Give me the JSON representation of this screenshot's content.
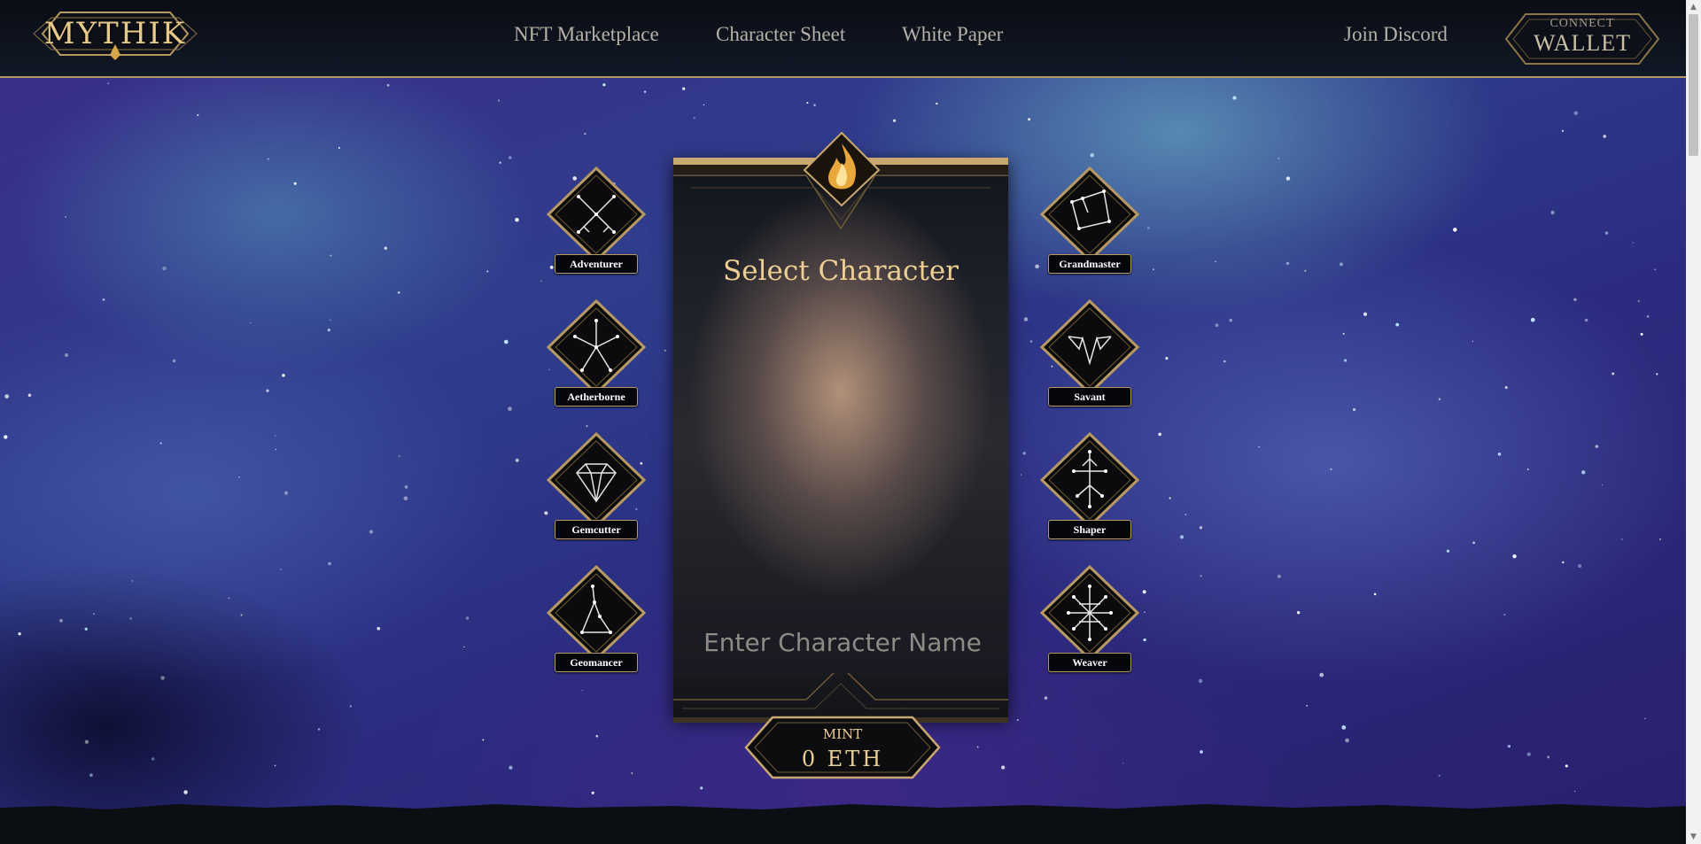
{
  "header": {
    "logo_text": "MYTHIK",
    "nav": [
      {
        "label": "NFT Marketplace"
      },
      {
        "label": "Character Sheet"
      },
      {
        "label": "White Paper"
      }
    ],
    "discord_label": "Join Discord",
    "wallet": {
      "top_label": "CONNECT",
      "main_label": "WALLET"
    }
  },
  "classes_left": [
    {
      "label": "Adventurer",
      "icon": "swords-icon"
    },
    {
      "label": "Aetherborne",
      "icon": "aether-star-icon"
    },
    {
      "label": "Gemcutter",
      "icon": "gem-icon"
    },
    {
      "label": "Geomancer",
      "icon": "geomancer-constellation-icon"
    }
  ],
  "classes_right": [
    {
      "label": "Grandmaster",
      "icon": "grandmaster-constellation-icon"
    },
    {
      "label": "Savant",
      "icon": "savant-crown-icon"
    },
    {
      "label": "Shaper",
      "icon": "shaper-tree-icon"
    },
    {
      "label": "Weaver",
      "icon": "weaver-web-icon"
    }
  ],
  "card": {
    "title": "Select Character",
    "name_placeholder": "Enter Character Name",
    "name_value": ""
  },
  "mint": {
    "label": "MINT",
    "price": "0 ETH"
  },
  "colors": {
    "gold": "#b79a63",
    "title_gold": "#edcf94",
    "header_bg": "#0a0d14"
  }
}
